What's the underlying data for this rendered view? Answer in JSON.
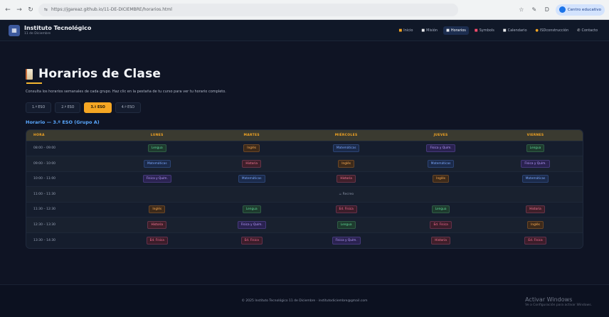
{
  "browser": {
    "url": "https://jgareaz.github.io/11-DE-DICIEMBRE/horarios.html",
    "profile": "Centro educativo"
  },
  "header": {
    "brand_title": "Instituto Tecnológico",
    "brand_subtitle": "11 de Diciembre",
    "nav": [
      {
        "icon": "home-icon",
        "glyph": "■",
        "label": "Inicio"
      },
      {
        "icon": "mission-icon",
        "glyph": "■",
        "label": "Misión"
      },
      {
        "icon": "book-icon",
        "glyph": "■",
        "label": "Horarios"
      },
      {
        "icon": "trophy-icon",
        "glyph": "■",
        "label": "Symbols"
      },
      {
        "icon": "calendar-icon",
        "glyph": "■",
        "label": "Calendario"
      },
      {
        "icon": "circle-icon",
        "glyph": "●",
        "label": "ISDconstrucción"
      },
      {
        "icon": "phone-icon",
        "glyph": "✆",
        "label": "Contacto"
      }
    ]
  },
  "page": {
    "title": "Horarios de Clase",
    "intro": "Consulta los horarios semanales de cada grupo. Haz clic en la pestaña de tu curso para ver tu horario completo.",
    "tabs": [
      "1.º ESO",
      "2.º ESO",
      "3.º ESO",
      "4.º ESO"
    ],
    "schedule_heading": "Horario — 3.º ESO (Grupo A)"
  },
  "table": {
    "headers": [
      "HORA",
      "LUNES",
      "MARTES",
      "MIÉRCOLES",
      "JUEVES",
      "VIERNES"
    ],
    "rows": [
      {
        "time": "08:00 – 09:00",
        "cells": [
          "Lengua",
          "Inglés",
          "Matemáticas",
          "Física y Quím.",
          "Lengua"
        ]
      },
      {
        "time": "09:00 – 10:00",
        "cells": [
          "Matemáticas",
          "Historia",
          "Inglés",
          "Matemáticas",
          "Física y Quím."
        ]
      },
      {
        "time": "10:00 – 11:00",
        "cells": [
          "Física y Quím.",
          "Matemáticas",
          "Historia",
          "Inglés",
          "Matemáticas"
        ]
      },
      {
        "time": "11:00 – 11:30",
        "recreo": "☕ Recreo"
      },
      {
        "time": "11:30 – 12:30",
        "cells": [
          "Inglés",
          "Lengua",
          "Ed. Física",
          "Lengua",
          "Historia"
        ]
      },
      {
        "time": "12:30 – 13:30",
        "cells": [
          "Historia",
          "Física y Quím.",
          "Lengua",
          "Ed. Física",
          "Inglés"
        ]
      },
      {
        "time": "13:30 – 14:30",
        "cells": [
          "Ed. Física",
          "Ed. Física",
          "Física y Quím.",
          "Historia",
          "Ed. Física"
        ]
      }
    ]
  },
  "footer": {
    "text": "© 2025 Instituto Tecnológico 11 de Diciembre · institutodiciembre@gmail.com"
  },
  "watermark": {
    "line1": "Activar Windows",
    "line2": "Ve a Configuración para activar Windows."
  }
}
